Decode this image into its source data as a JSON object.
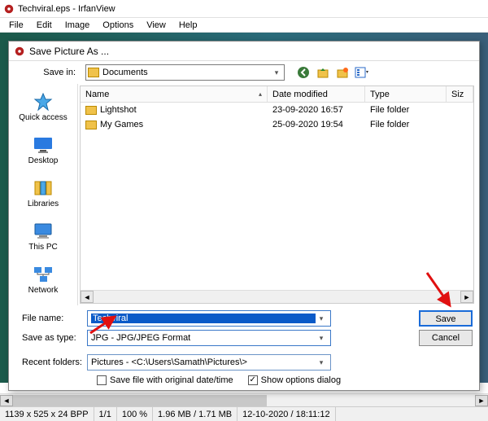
{
  "app": {
    "title": "Techviral.eps - IrfanView",
    "menus": [
      "File",
      "Edit",
      "Image",
      "Options",
      "View",
      "Help"
    ]
  },
  "dialog": {
    "title": "Save Picture As ...",
    "save_in_label": "Save in:",
    "save_in_value": "Documents",
    "columns": {
      "name": "Name",
      "date": "Date modified",
      "type": "Type",
      "size": "Siz"
    },
    "rows": [
      {
        "name": "Lightshot",
        "date": "23-09-2020 16:57",
        "type": "File folder"
      },
      {
        "name": "My Games",
        "date": "25-09-2020 19:54",
        "type": "File folder"
      }
    ],
    "places": {
      "quick": "Quick access",
      "desktop": "Desktop",
      "libraries": "Libraries",
      "thispc": "This PC",
      "network": "Network"
    },
    "filename_label": "File name:",
    "filename_value": "Techviral",
    "savetype_label": "Save as type:",
    "savetype_value": "JPG - JPG/JPEG Format",
    "recent_label": "Recent folders:",
    "recent_value": "Pictures  -  <C:\\Users\\Samath\\Pictures\\>",
    "save_btn": "Save",
    "cancel_btn": "Cancel",
    "chk_origdate": "Save file with original date/time",
    "chk_options": "Show options dialog"
  },
  "status": {
    "dims": "1139 x 525 x 24 BPP",
    "page": "1/1",
    "zoom": "100 %",
    "sizes": "1.96 MB / 1.71 MB",
    "datetime": "12-10-2020 / 18:11:12"
  }
}
